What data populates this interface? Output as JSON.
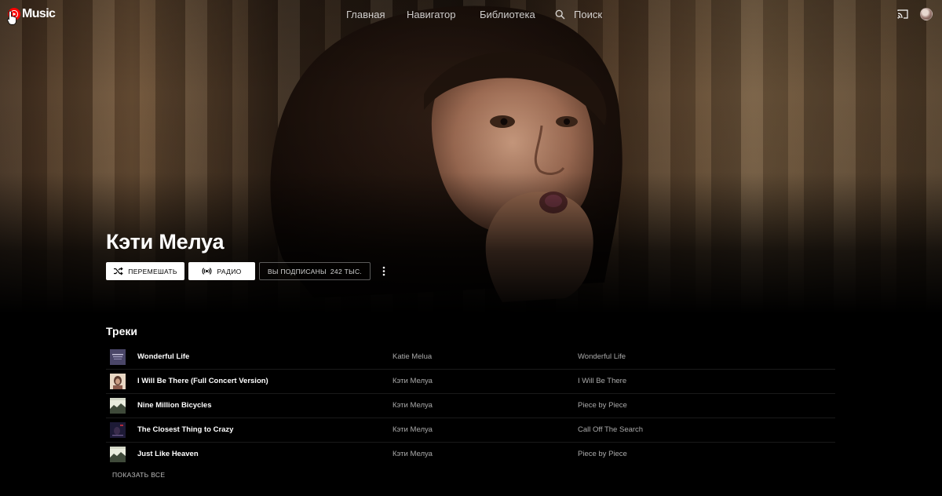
{
  "app": {
    "logo_text": "Music",
    "accent_color": "#ff0000"
  },
  "nav": {
    "items": [
      {
        "label": "Главная"
      },
      {
        "label": "Навигатор"
      },
      {
        "label": "Библиотека"
      },
      {
        "label": "Поиск",
        "icon": "search-icon"
      }
    ]
  },
  "header_icons": [
    "cast-icon",
    "avatar"
  ],
  "artist": {
    "name": "Кэти Мелуа",
    "actions": {
      "shuffle_label": "ПЕРЕМЕШАТЬ",
      "radio_label": "РАДИО",
      "subscribed_label": "ВЫ ПОДПИСАНЫ",
      "subscribers": "242 ТЫС."
    }
  },
  "tracks_section": {
    "title": "Треки",
    "show_all_label": "ПОКАЗАТЬ ВСЕ",
    "items": [
      {
        "title": "Wonderful Life",
        "artist": "Katie Melua",
        "album": "Wonderful Life"
      },
      {
        "title": "I Will Be There (Full Concert Version)",
        "artist": "Кэти Мелуа",
        "album": "I Will Be There"
      },
      {
        "title": "Nine Million Bicycles",
        "artist": "Кэти Мелуа",
        "album": "Piece by Piece"
      },
      {
        "title": "The Closest Thing to Crazy",
        "artist": "Кэти Мелуа",
        "album": "Call Off The Search"
      },
      {
        "title": "Just Like Heaven",
        "artist": "Кэти Мелуа",
        "album": "Piece by Piece"
      }
    ]
  }
}
